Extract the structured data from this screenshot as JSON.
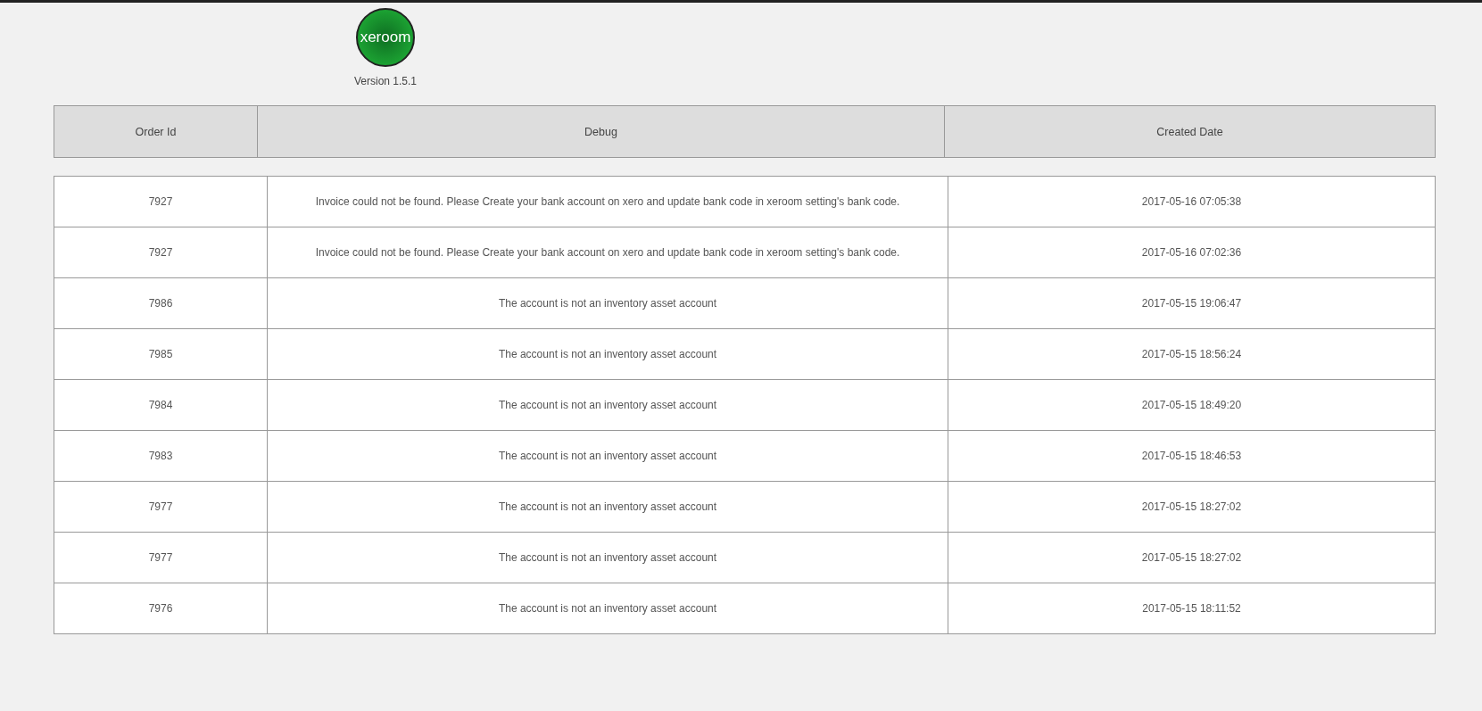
{
  "logo": {
    "text": "xeroom"
  },
  "version": "Version 1.5.1",
  "table": {
    "columns": [
      "Order Id",
      "Debug",
      "Created Date"
    ],
    "rows": [
      [
        "7927",
        "Invoice could not be found. Please Create your bank account on xero and update bank code in xeroom setting's bank code.",
        "2017-05-16 07:05:38"
      ],
      [
        "7927",
        "Invoice could not be found. Please Create your bank account on xero and update bank code in xeroom setting's bank code.",
        "2017-05-16 07:02:36"
      ],
      [
        "7986",
        "The account is not an inventory asset account",
        "2017-05-15 19:06:47"
      ],
      [
        "7985",
        "The account is not an inventory asset account",
        "2017-05-15 18:56:24"
      ],
      [
        "7984",
        "The account is not an inventory asset account",
        "2017-05-15 18:49:20"
      ],
      [
        "7983",
        "The account is not an inventory asset account",
        "2017-05-15 18:46:53"
      ],
      [
        "7977",
        "The account is not an inventory asset account",
        "2017-05-15 18:27:02"
      ],
      [
        "7977",
        "The account is not an inventory asset account",
        "2017-05-15 18:27:02"
      ],
      [
        "7976",
        "The account is not an inventory asset account",
        "2017-05-15 18:11:52"
      ]
    ]
  }
}
